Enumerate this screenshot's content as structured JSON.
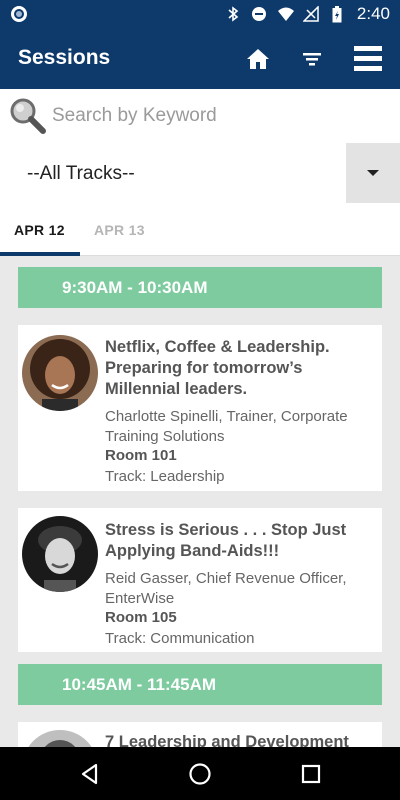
{
  "status_bar": {
    "time": "2:40",
    "icons": [
      "bluetooth-icon",
      "dnd-icon",
      "wifi-icon",
      "signal-icon",
      "battery-icon"
    ]
  },
  "app_bar": {
    "title": "Sessions",
    "actions": [
      "home-icon",
      "filter-icon",
      "menu-icon"
    ],
    "color": "#0d3a6b"
  },
  "search": {
    "placeholder": "Search by Keyword",
    "value": ""
  },
  "track_filter": {
    "selected": "--All Tracks--"
  },
  "tabs": [
    {
      "label": "APR 12",
      "active": true
    },
    {
      "label": "APR 13",
      "active": false
    }
  ],
  "time_slots": [
    {
      "label": "9:30AM - 10:30AM"
    },
    {
      "label": "10:45AM - 11:45AM"
    }
  ],
  "sessions": [
    {
      "title": "Netflix, Coffee & Leadership. Preparing for tomorrow’s Millennial leaders.",
      "speaker": "Charlotte Spinelli, Trainer, Corporate Training Solutions",
      "room": "Room 101",
      "track": "Track: Leadership"
    },
    {
      "title": "Stress is Serious . . . Stop Just Applying Band-Aids!!!",
      "speaker": "Reid Gasser, Chief Revenue Officer, EnterWise",
      "room": "Room 105",
      "track": "Track: Communication"
    },
    {
      "title": "7 Leadership and Development"
    }
  ],
  "colors": {
    "time_header": "#7fcba0",
    "tab_indicator": "#0d3a6b"
  }
}
